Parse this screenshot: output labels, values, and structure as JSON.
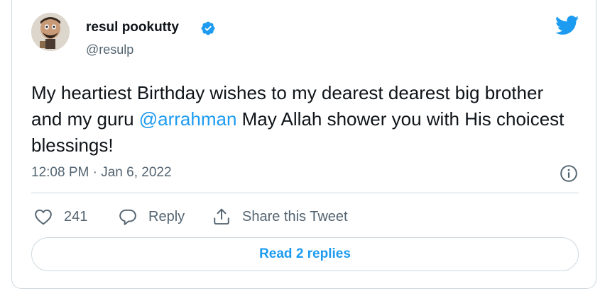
{
  "tweet": {
    "author_name": "resul pookutty",
    "handle": "@resulp",
    "text_part1": "My heartiest Birthday wishes to my dearest dearest big brother and my guru ",
    "mention": "@arrahman",
    "text_part2": " May Allah shower you with His choicest blessings!",
    "timestamp": "12:08 PM · Jan 6, 2022"
  },
  "actions": {
    "likes": "241",
    "reply_label": "Reply",
    "share_label": "Share this Tweet"
  },
  "read_replies_label": "Read 2 replies",
  "colors": {
    "accent": "#1d9bf0",
    "text": "#0f1419",
    "secondary": "#536471",
    "border": "#cfd9de"
  },
  "icons": [
    "verified-badge-icon",
    "twitter-bird-icon",
    "info-icon",
    "heart-icon",
    "reply-bubble-icon",
    "share-icon"
  ]
}
